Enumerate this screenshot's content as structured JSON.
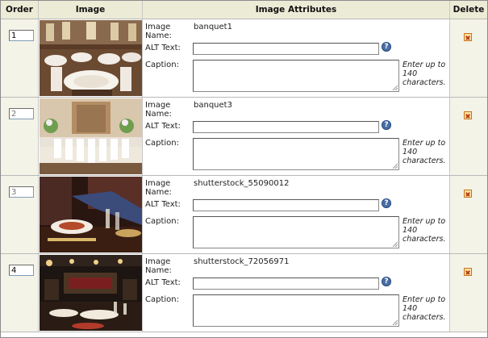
{
  "headers": {
    "order": "Order",
    "image": "Image",
    "attributes": "Image Attributes",
    "delete": "Delete"
  },
  "labels": {
    "image_name": "Image\nName:",
    "alt_text": "ALT Text:",
    "caption": "Caption:",
    "caption_note": "Enter up to 140 characters.",
    "help": "?"
  },
  "rows": [
    {
      "order": "1",
      "image_name": "banquet1",
      "alt_text": "",
      "caption": "",
      "thumb_icon": "banquet-hall-photo"
    },
    {
      "order": "2",
      "image_name": "banquet3",
      "alt_text": "",
      "caption": "",
      "thumb_icon": "banquet-hall-photo"
    },
    {
      "order": "3",
      "image_name": "shutterstock_55090012",
      "alt_text": "",
      "caption": "",
      "thumb_icon": "dinner-table-photo"
    },
    {
      "order": "4",
      "image_name": "shutterstock_72056971",
      "alt_text": "",
      "caption": "",
      "thumb_icon": "restaurant-interior-photo"
    }
  ],
  "colors": {
    "header_bg": "#ecebd6",
    "side_bg": "#f4f3e7",
    "help_icon": "#4a6fa5",
    "delete_icon": "#c8741a"
  }
}
